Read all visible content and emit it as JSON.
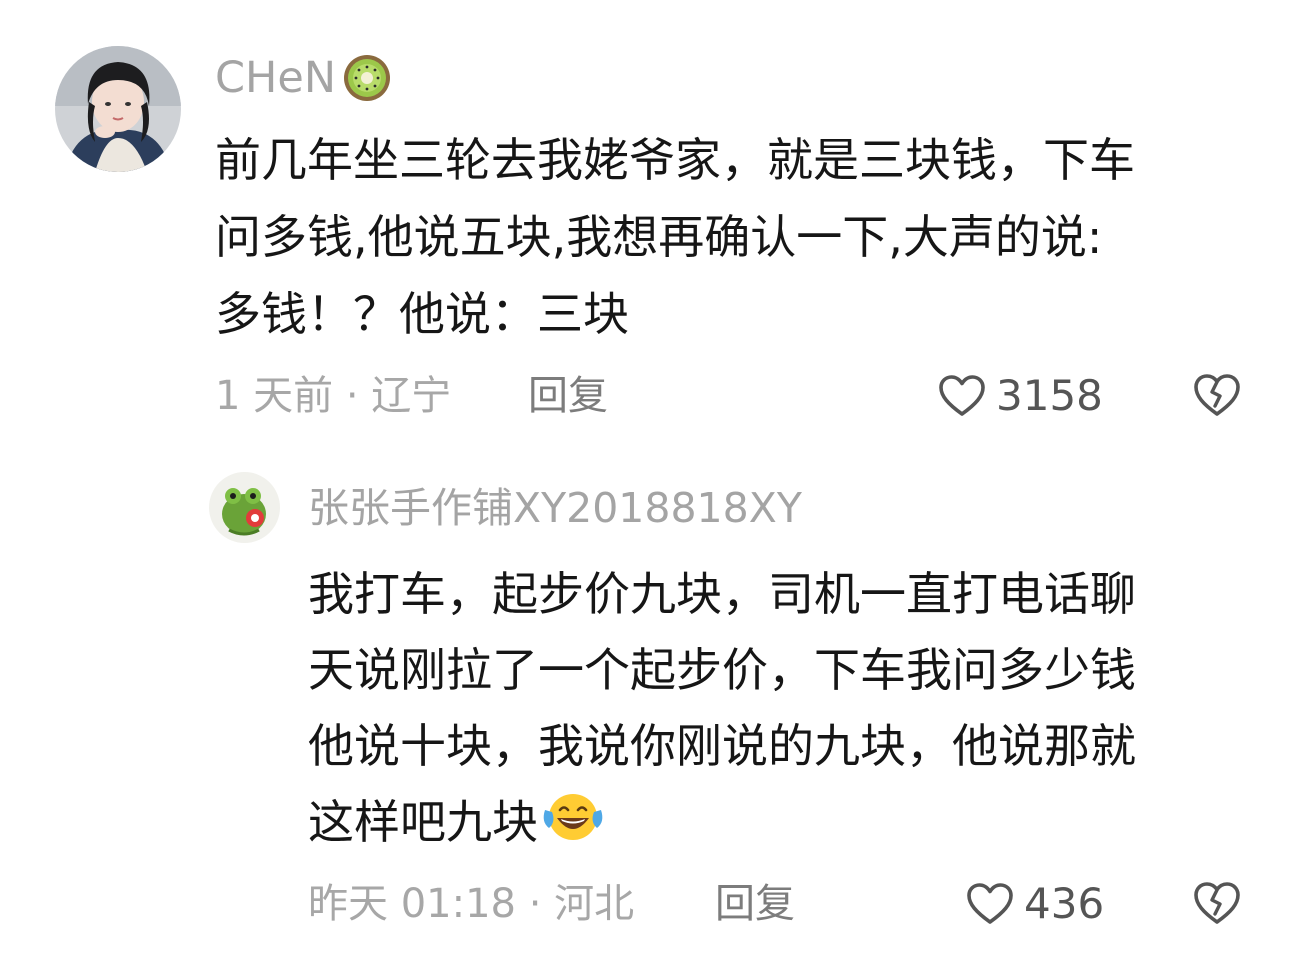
{
  "comments": [
    {
      "username": "CHeN",
      "username_emoji": "kiwi-icon",
      "text": "前几年坐三轮去我姥爷家，就是三块钱，下车\n问多钱,他说五块,我想再确认一下,大声的说:\n多钱！？他说：三块",
      "time_location": "1 天前 · 辽宁",
      "reply_label": "回复",
      "likes": "3158"
    },
    {
      "username": "张张手作铺XY2018818XY",
      "text": "我打车，起步价九块，司机一直打电话聊\n天说刚拉了一个起步价，下车我问多少钱\n他说十块，我说你刚说的九块，他说那就\n这样吧九块",
      "trailing_emoji": "tears-of-joy-icon",
      "time_location": "昨天 01:18 · 河北",
      "reply_label": "回复",
      "likes": "436"
    }
  ],
  "colors": {
    "text": "#161616",
    "meta": "#a7a7a7",
    "username": "#a4a4a4",
    "icon": "#555555"
  }
}
